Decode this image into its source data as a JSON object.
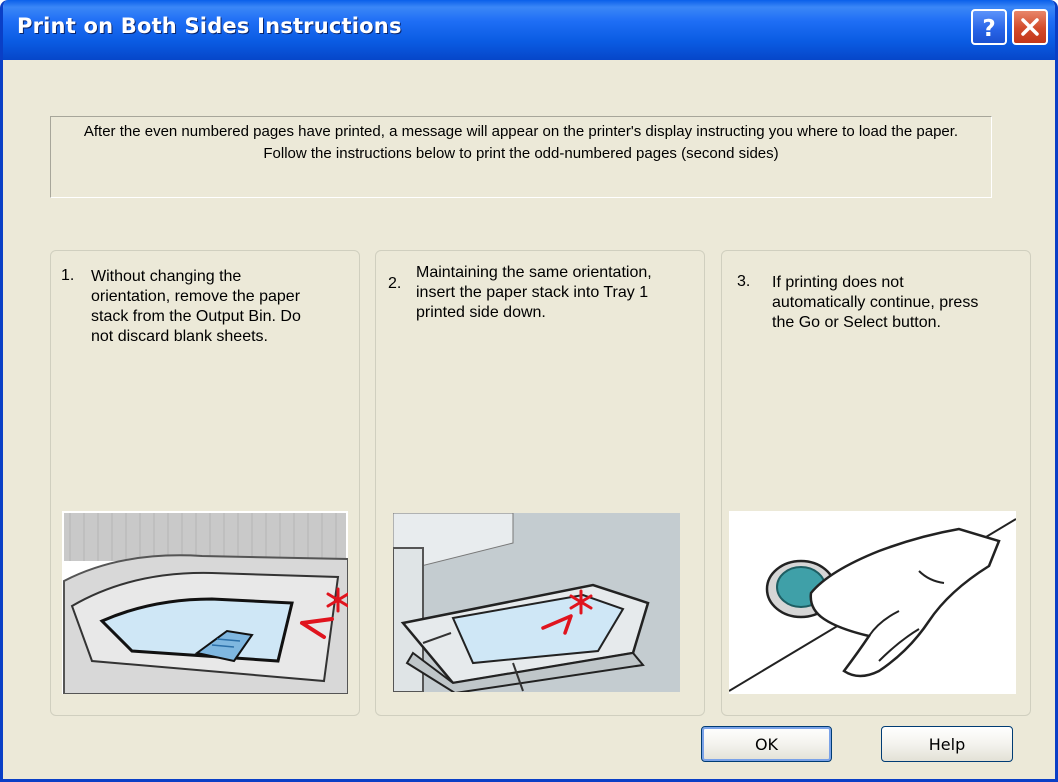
{
  "window": {
    "title": "Print on Both Sides Instructions",
    "help_icon": "question-mark-icon",
    "close_icon": "close-x-icon",
    "titlebar_color": "#0a5be2"
  },
  "intro_text": "After the even numbered pages have printed, a message will appear on the printer's display instructing you where to load the paper. Follow the instructions below to print the odd-numbered pages (second sides)",
  "steps": [
    {
      "number": "1.",
      "text": "Without changing the orientation, remove the paper stack from the Output Bin.  Do not discard blank sheets.",
      "image": "output-bin-paper-illustration"
    },
    {
      "number": "2.",
      "text": "Maintaining the same orientation, insert the paper stack into Tray 1 printed side down.",
      "image": "tray-insert-illustration"
    },
    {
      "number": "3.",
      "text": "If printing does not automatically continue, press the Go or Select button.",
      "image": "press-button-illustration"
    }
  ],
  "buttons": {
    "ok": "OK",
    "help": "Help"
  },
  "colors": {
    "accent_red": "#e0141e",
    "paper_blue": "#cfe7f6",
    "button_teal": "#3fa0a8"
  }
}
